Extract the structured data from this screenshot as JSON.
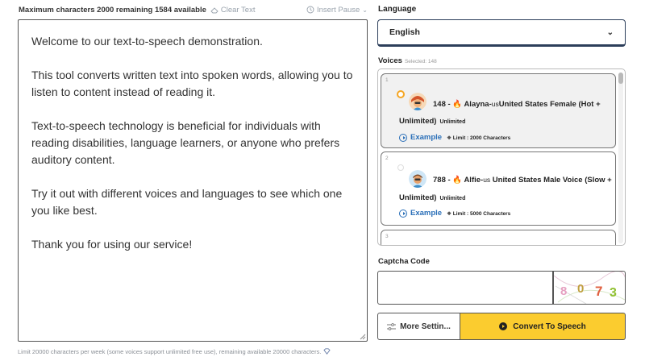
{
  "header": {
    "limits_text": "Maximum characters 2000 remaining 1584 available",
    "clear_label": "Clear Text",
    "insert_pause_label": "Insert Pause"
  },
  "editor": {
    "paragraphs": [
      "Welcome to our text-to-speech demonstration.",
      "This tool converts written text into spoken words, allowing you to listen to content instead of reading it.",
      "Text-to-speech technology is beneficial for individuals with reading disabilities, language learners, or anyone who prefers auditory content.",
      "Try it out with different voices and languages to see which one you like best.",
      "Thank you for using our service!"
    ]
  },
  "footnote": "Limit 20000 characters per week (some voices support unlimited free use), remaining available 20000 characters.",
  "language": {
    "label": "Language",
    "selected": "English"
  },
  "voices": {
    "label": "Voices",
    "selected_text": "Selected: 148",
    "items": [
      {
        "index": "1",
        "id_prefix": "148 -",
        "name": "Alayna-",
        "country_code": "us",
        "description": "United States Female (Hot +",
        "title_line2": "Unlimited)",
        "unlimited_tag": "Unlimited",
        "example_label": "Example",
        "limit_text": "Limit : 2000 Characters",
        "selected": true
      },
      {
        "index": "2",
        "id_prefix": "788 -",
        "name": "Alfie-",
        "country_code": "us",
        "description": " United States Male Voice (Slow +",
        "title_line2": "Unlimited)",
        "unlimited_tag": "Unlimited",
        "example_label": "Example",
        "limit_text": "Limit : 5000 Characters",
        "selected": false
      },
      {
        "index": "3"
      }
    ]
  },
  "captcha": {
    "label": "Captcha Code",
    "input_value": "",
    "image_text": "8 0 7 3"
  },
  "buttons": {
    "more_settings": "More Settin...",
    "convert": "Convert To Speech"
  },
  "colors": {
    "accent_yellow": "#fbcc2f",
    "link_blue": "#2a6fb8",
    "radio_orange": "#f5a623",
    "fire_orange": "#f08c1a"
  }
}
